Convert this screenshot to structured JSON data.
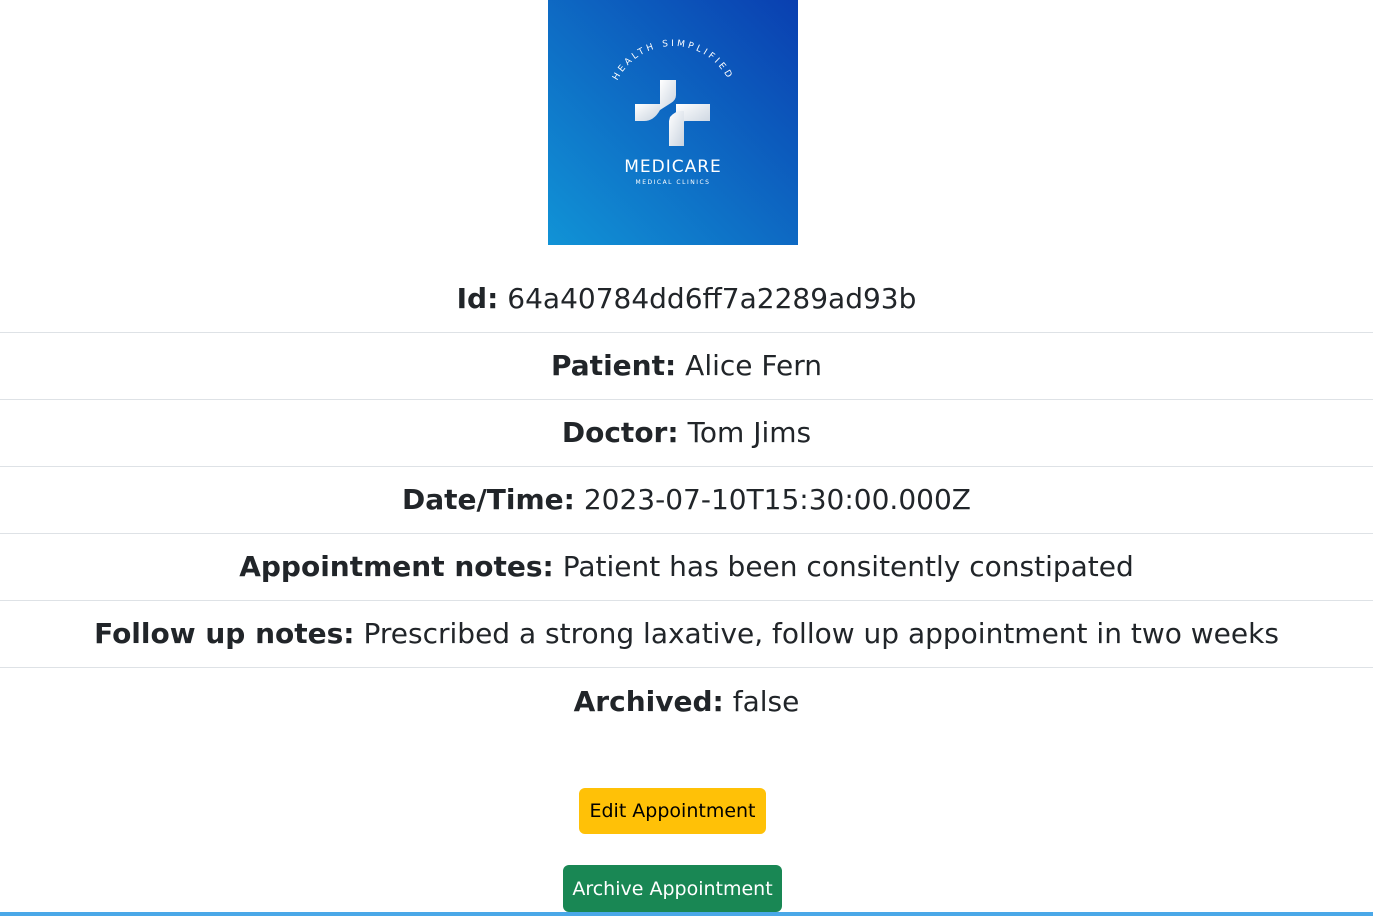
{
  "logo": {
    "tagline": "HEALTH SIMPLIFIED",
    "name": "MEDICARE",
    "subtitle": "MEDICAL CLINICS",
    "colors": {
      "gradient_start": "#1193d6",
      "gradient_end": "#0a3fb0"
    }
  },
  "details": [
    {
      "label": "Id:",
      "value": "64a40784dd6ff7a2289ad93b"
    },
    {
      "label": "Patient:",
      "value": "Alice Fern"
    },
    {
      "label": "Doctor:",
      "value": "Tom Jims"
    },
    {
      "label": "Date/Time:",
      "value": "2023-07-10T15:30:00.000Z"
    },
    {
      "label": "Appointment notes:",
      "value": "Patient has been consitently constipated"
    },
    {
      "label": "Follow up notes:",
      "value": "Prescribed a strong laxative, follow up appointment in two weeks"
    },
    {
      "label": "Archived:",
      "value": "false"
    }
  ],
  "actions": {
    "edit_label": "Edit Appointment",
    "archive_label": "Archive Appointment"
  },
  "colors": {
    "edit_button": "#ffc107",
    "archive_button": "#198754",
    "row_divider": "#dee2e6",
    "bottom_line": "#4aa8e8"
  }
}
